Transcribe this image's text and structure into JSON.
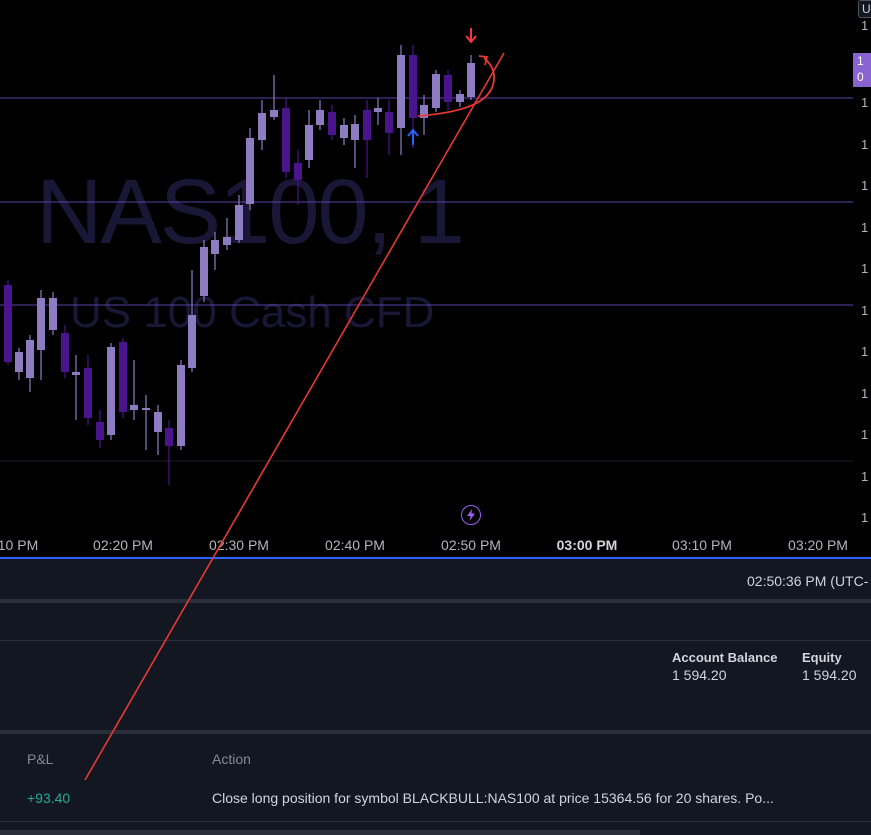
{
  "chart": {
    "symbol_watermark": "NAS100, 1",
    "description_watermark": "US 100 Cash CFD",
    "corner_button": "U",
    "price_tag_lines": [
      "1",
      "0"
    ],
    "price_ticks": [
      "1",
      "1",
      "1",
      "1",
      "1",
      "1",
      "1",
      "1",
      "1",
      "1",
      "1",
      "1"
    ],
    "time_labels": [
      "10 PM",
      "02:20 PM",
      "02:30 PM",
      "02:40 PM",
      "02:50 PM",
      "03:00 PM",
      "03:10 PM",
      "03:20 PM"
    ],
    "bold_time_label": "03:00 PM",
    "colors": {
      "background": "#000000",
      "candle_light": "#8e7cc3",
      "candle_dark": "#4a148c",
      "horizontal_line": "#5b3fa8",
      "annotation": "#e53935",
      "buy_arrow": "#2962ff",
      "sell_arrow": "#f23645"
    },
    "icons": [
      "flash-icon",
      "buy-arrow-icon",
      "sell-arrow-icon"
    ]
  },
  "status": {
    "clock": "02:50:36 PM (UTC-"
  },
  "account": {
    "balance_label": "Account Balance",
    "balance_value": "1 594.20",
    "equity_label": "Equity",
    "equity_value": "1 594.20"
  },
  "history": {
    "columns": {
      "pnl": "P&L",
      "action": "Action"
    },
    "rows": [
      {
        "pnl": "+93.40",
        "action": "Close long position for symbol BLACKBULL:NAS100 at price 15364.56 for 20 shares. Po..."
      }
    ]
  }
}
